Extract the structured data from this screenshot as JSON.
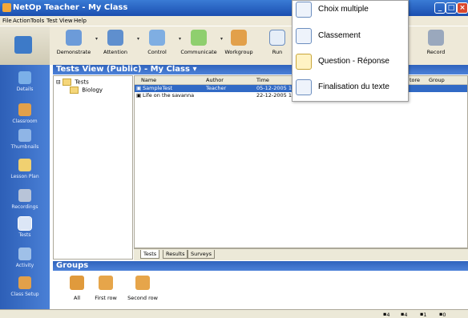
{
  "window": {
    "title": "NetOp Teacher - My Class"
  },
  "menubar": [
    "File",
    "Action",
    "Tools",
    "Test View",
    "Help"
  ],
  "toolbar": {
    "buttons": [
      "Demonstrate",
      "Attention",
      "Control",
      "Communicate",
      "Workgroup",
      "Run",
      "Record"
    ]
  },
  "sidebar": {
    "items": [
      "Details",
      "Classroom",
      "Thumbnails",
      "Lesson Plan",
      "Recordings",
      "Tests",
      "Activity",
      "Class Setup"
    ],
    "selected": "Tests"
  },
  "view_header": {
    "title": "Tests View (Public) - My Class"
  },
  "tree": {
    "root": "Tests",
    "child": "Biology"
  },
  "list": {
    "columns": [
      "Name",
      "Author",
      "Time",
      "tore",
      "Group"
    ],
    "rows": [
      {
        "name": "SampleTest",
        "author": "Teacher",
        "time": "05-12-2005 1",
        "selected": true
      },
      {
        "name": "Life on the savanna",
        "author": "",
        "time": "22-12-2005 1",
        "selected": false
      }
    ]
  },
  "tabs": [
    "Tests",
    "Results",
    "Surveys"
  ],
  "groups": {
    "title": "Groups",
    "items": [
      "All",
      "First row",
      "Second row"
    ]
  },
  "statusbar": {
    "counts": [
      "4",
      "4",
      "1",
      "0"
    ]
  },
  "popup": {
    "items": [
      "Choix multiple",
      "Classement",
      "Question - Réponse",
      "Finalisation du texte"
    ]
  },
  "colors": {
    "titlebar": "#1b4fb0",
    "header": "#2f63bd",
    "selection": "#316ac5",
    "chrome": "#ece9d8"
  }
}
